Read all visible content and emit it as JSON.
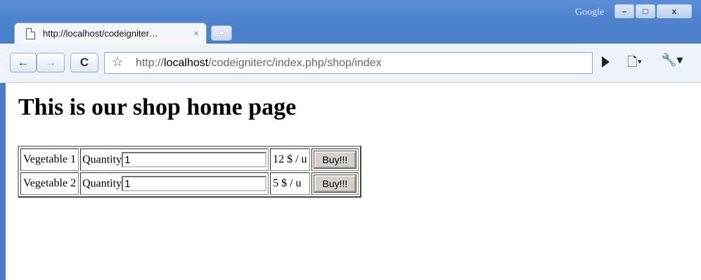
{
  "window": {
    "brand": "Google",
    "minimize": "–",
    "maximize": "□",
    "close": "x"
  },
  "tab": {
    "title": "http://localhost/codeigniter…",
    "close": "×",
    "new_tab": "+"
  },
  "toolbar": {
    "back": "←",
    "forward": "→",
    "reload": "C",
    "star": "☆",
    "url_prefix": "http://",
    "url_host": "localhost",
    "url_path": "/codeigniterc/index.php/shop/index",
    "page_menu": "🗋▾",
    "tools_menu": "🔧▾"
  },
  "page": {
    "heading": "This is our shop home page",
    "rows": [
      {
        "name": "Vegetable 1",
        "qty_label": "Quantity",
        "qty_value": "1",
        "price": "12 $ / u",
        "buy_label": "Buy!!!"
      },
      {
        "name": "Vegetable 2",
        "qty_label": "Quantity",
        "qty_value": "1",
        "price": "5 $ / u",
        "buy_label": "Buy!!!"
      }
    ]
  },
  "colors": {
    "frame": "#4a7fc8",
    "toolbar": "#eef3fa"
  }
}
